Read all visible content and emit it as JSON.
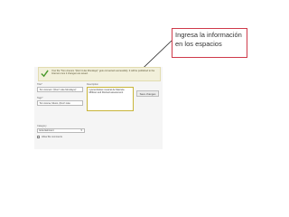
{
  "callout": {
    "text": "Ingresa la información en los espacios"
  },
  "notice": {
    "text": "Your file \"Tom Arena's \"(Don't Like Mondays)\" gets converted successfully. It will be published to the Internet once it changes are saved."
  },
  "form": {
    "title_label": "Title*",
    "title_value": "Tom Arena's \"(Don't Like Mondays)\"",
    "description_label": "Description",
    "description_value": "nyecembelasi musical de Marcela Millican and Rocked assessment",
    "save_button": "Save changes",
    "tags_label": "Tags*",
    "tags_value": "Tom Arena, Music, (Don't Like Mondays)",
    "category_label": "Category",
    "category_value": "Entertainment",
    "checkbox_label": "Allow file comments"
  },
  "colors": {
    "callout_border": "#cf3a4a",
    "notice_bg": "#f2f0db",
    "check_green": "#4a9a2e",
    "description_focus": "#c8b53a"
  }
}
